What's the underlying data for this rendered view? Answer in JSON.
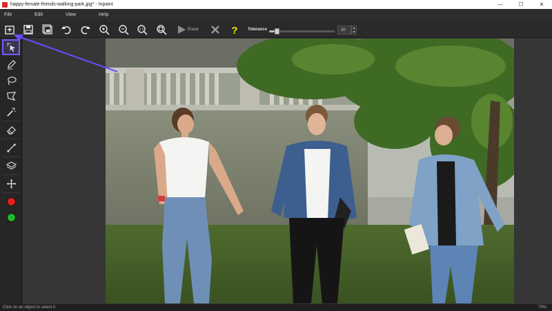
{
  "window": {
    "title": "happy-female-friends-walking-park.jpg* - Inpaint",
    "controls": [
      "—",
      "☐",
      "✕"
    ]
  },
  "menu": [
    "File",
    "Edit",
    "View",
    "Help"
  ],
  "toolbar": {
    "erase_label": "Erase",
    "tolerance_label": "Tolerance",
    "tolerance_value": "30",
    "tolerance_fraction": 0.08
  },
  "tools": [
    "marker-selection",
    "pencil",
    "lasso",
    "polygonal-lasso",
    "magic-wand",
    "eraser",
    "line",
    "layers",
    "move"
  ],
  "colors": {
    "red": "#e0201c",
    "green": "#1fb828",
    "accent": "#7a5cff",
    "arrow": "#6a4cff"
  },
  "status": {
    "text": "Click on an object to select it",
    "zoom": "79%"
  }
}
